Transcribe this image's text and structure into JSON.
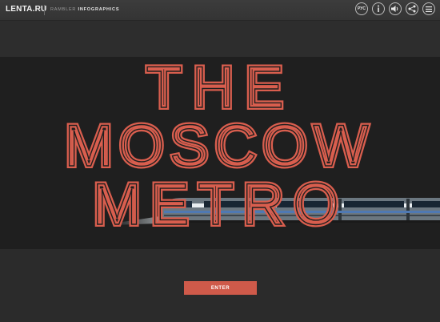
{
  "header": {
    "logo": "LENTA.RU",
    "brand_prefix": "RAMBLER",
    "brand_strong": "INFOGRAPHICS",
    "language_button": "РУС"
  },
  "hero": {
    "title_line1": "THE",
    "title_line2": "MOSCOW",
    "title_line3": "METRO",
    "title_color": "#d95e4e"
  },
  "actions": {
    "enter_label": "ENTER"
  },
  "colors": {
    "background": "#2b2b2b",
    "band_dark": "#1f1f1f",
    "accent": "#cf5a4a"
  },
  "icons": [
    "info-icon",
    "sound-icon",
    "share-icon",
    "menu-icon"
  ]
}
